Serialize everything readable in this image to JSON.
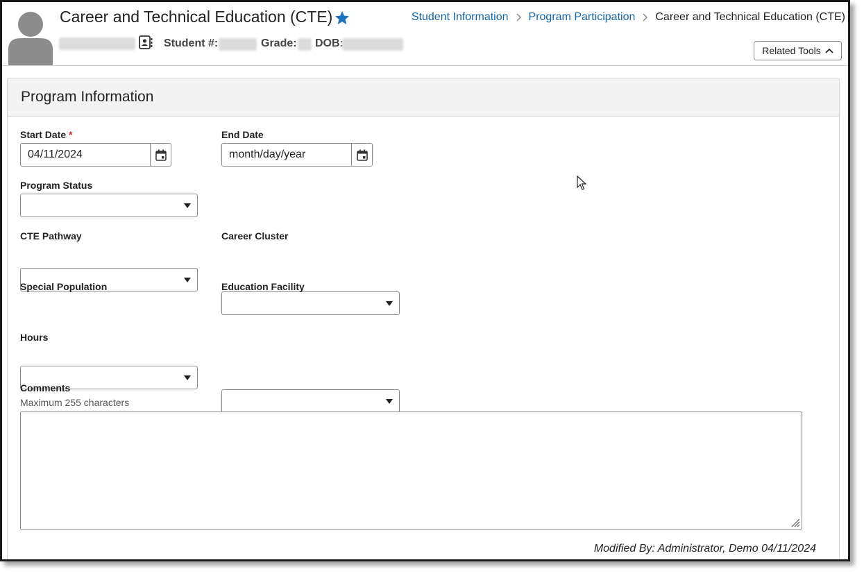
{
  "header": {
    "title": "Career and Technical Education (CTE)",
    "breadcrumb": [
      "Student Information",
      "Program Participation",
      "Career and Technical Education (CTE)"
    ],
    "student_label": "Student #:",
    "grade_label": "Grade:",
    "dob_label": "DOB:",
    "related_tools_label": "Related Tools"
  },
  "panel": {
    "title": "Program Information"
  },
  "form": {
    "start_date_label": "Start Date",
    "required_mark": "*",
    "start_date_value": "04/11/2024",
    "end_date_label": "End Date",
    "end_date_placeholder": "month/day/year",
    "program_status_label": "Program Status",
    "cte_pathway_label": "CTE Pathway",
    "career_cluster_label": "Career Cluster",
    "special_population_label": "Special Population",
    "education_facility_label": "Education Facility",
    "hours_label": "Hours",
    "comments_label": "Comments",
    "comments_hint": "Maximum 255 characters"
  },
  "footer": {
    "modified": "Modified By: Administrator, Demo 04/11/2024"
  },
  "colors": {
    "link": "#1565a6",
    "star": "#1e73be",
    "required": "#c62828"
  }
}
